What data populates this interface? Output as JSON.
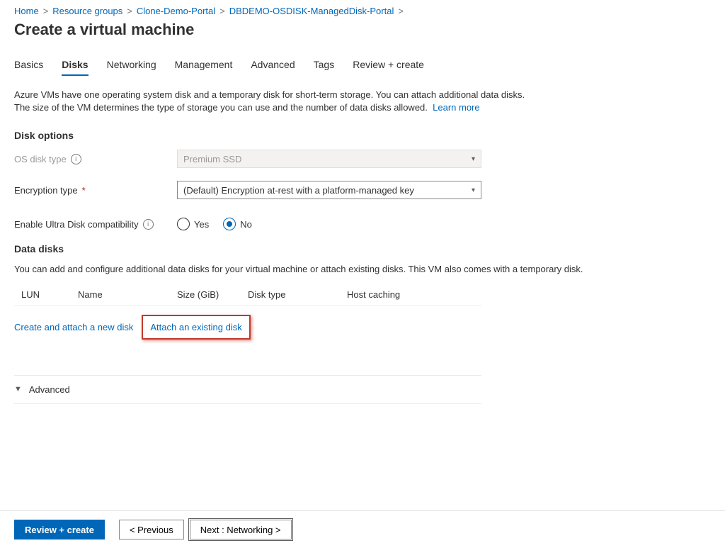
{
  "breadcrumb": {
    "items": [
      "Home",
      "Resource groups",
      "Clone-Demo-Portal",
      "DBDEMO-OSDISK-ManagedDisk-Portal"
    ]
  },
  "title": "Create a virtual machine",
  "tabs": {
    "items": [
      "Basics",
      "Disks",
      "Networking",
      "Management",
      "Advanced",
      "Tags",
      "Review + create"
    ],
    "active": "Disks"
  },
  "intro": {
    "line1": "Azure VMs have one operating system disk and a temporary disk for short-term storage. You can attach additional data disks.",
    "line2": "The size of the VM determines the type of storage you can use and the number of data disks allowed.",
    "learn": "Learn more"
  },
  "disk_options": {
    "heading": "Disk options",
    "os_disk_label": "OS disk type",
    "os_disk_value": "Premium SSD",
    "encryption_label": "Encryption type",
    "encryption_value": "(Default) Encryption at-rest with a platform-managed key",
    "ultra_label": "Enable Ultra Disk compatibility",
    "ultra_yes": "Yes",
    "ultra_no": "No",
    "ultra_selected": "No"
  },
  "data_disks": {
    "heading": "Data disks",
    "subtext": "You can add and configure additional data disks for your virtual machine or attach existing disks. This VM also comes with a temporary disk.",
    "columns": {
      "lun": "LUN",
      "name": "Name",
      "size": "Size (GiB)",
      "type": "Disk type",
      "cache": "Host caching"
    },
    "action_create": "Create and attach a new disk",
    "action_attach": "Attach an existing disk"
  },
  "advanced_label": "Advanced",
  "footer": {
    "review": "Review + create",
    "prev": "< Previous",
    "next": "Next : Networking >"
  }
}
